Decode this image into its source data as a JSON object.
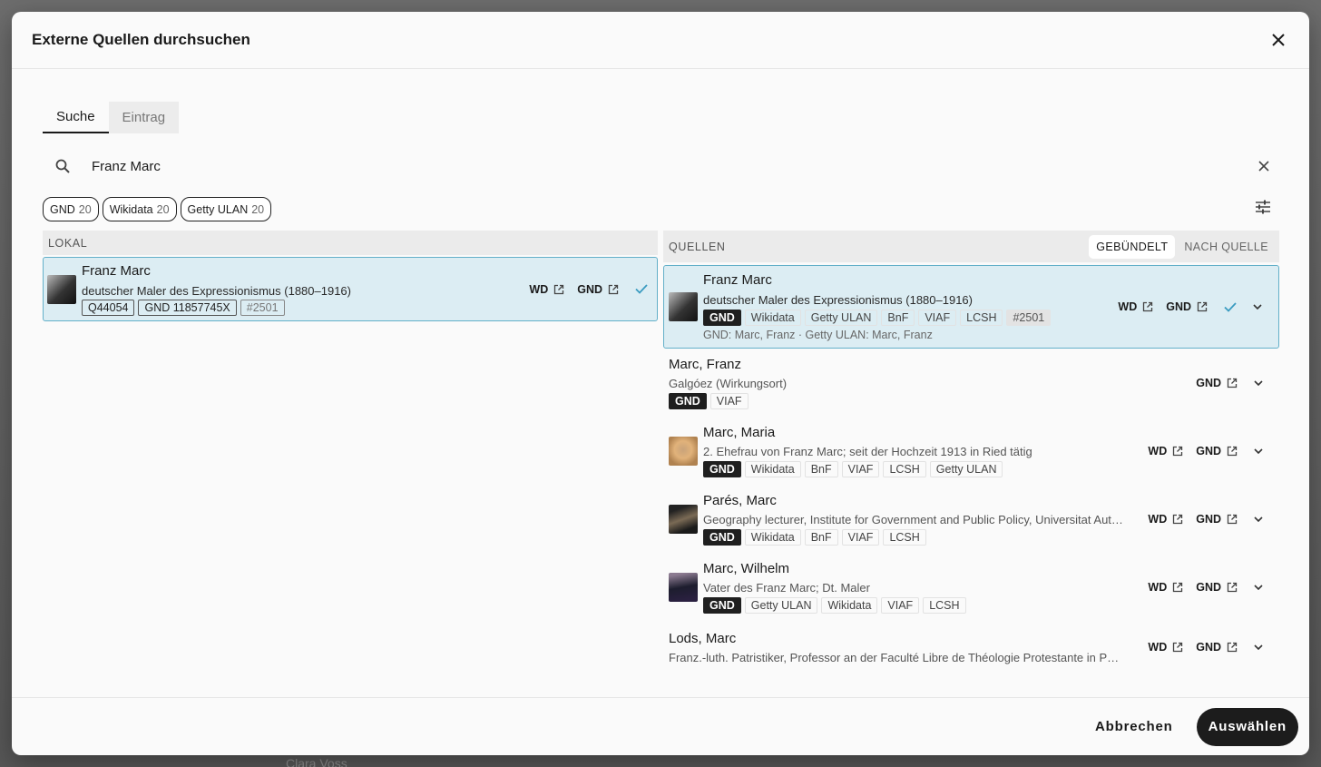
{
  "background": {
    "text": "Clara Voss"
  },
  "dialog": {
    "title": "Externe Quellen durchsuchen"
  },
  "tabs": [
    {
      "label": "Suche",
      "active": true
    },
    {
      "label": "Eintrag",
      "active": false
    }
  ],
  "search": {
    "value": "Franz Marc",
    "placeholder": ""
  },
  "chips": [
    {
      "label": "GND",
      "count": "20"
    },
    {
      "label": "Wikidata",
      "count": "20"
    },
    {
      "label": "Getty ULAN",
      "count": "20"
    }
  ],
  "local": {
    "header": "LOKAL",
    "items": [
      {
        "title": "Franz Marc",
        "subtitle": "deutscher Maler des Expressionismus (1880–1916)",
        "tags": [
          "Q44054",
          "GND 11857745X",
          "#2501"
        ],
        "links": [
          "WD",
          "GND"
        ]
      }
    ]
  },
  "sources": {
    "header": "QUELLEN",
    "modes": [
      "GEBÜNDELT",
      "NACH QUELLE"
    ],
    "items": [
      {
        "title": "Franz Marc",
        "subtitle": "deutscher Maler des Expressionismus (1880–1916)",
        "tags": [
          "GND",
          "Wikidata",
          "Getty ULAN",
          "BnF",
          "VIAF",
          "LCSH",
          "#2501"
        ],
        "note": "GND: Marc, Franz · Getty ULAN: Marc, Franz",
        "links": [
          "WD",
          "GND"
        ]
      },
      {
        "title": "Marc, Franz",
        "subtitle": "Galgóez (Wirkungsort)",
        "tags": [
          "GND",
          "VIAF"
        ],
        "links": [
          "GND"
        ]
      },
      {
        "title": "Marc, Maria",
        "subtitle": "2. Ehefrau von Franz Marc; seit der Hochzeit 1913 in Ried tätig",
        "tags": [
          "GND",
          "Wikidata",
          "BnF",
          "VIAF",
          "LCSH",
          "Getty ULAN"
        ],
        "links": [
          "WD",
          "GND"
        ]
      },
      {
        "title": "Parés, Marc",
        "subtitle": "Geography lecturer, Institute for Government and Public Policy, Universitat Autòn...",
        "tags": [
          "GND",
          "Wikidata",
          "BnF",
          "VIAF",
          "LCSH"
        ],
        "links": [
          "WD",
          "GND"
        ]
      },
      {
        "title": "Marc, Wilhelm",
        "subtitle": "Vater des Franz Marc; Dt. Maler",
        "tags": [
          "GND",
          "Getty ULAN",
          "Wikidata",
          "VIAF",
          "LCSH"
        ],
        "links": [
          "WD",
          "GND"
        ]
      },
      {
        "title": "Lods, Marc",
        "subtitle": "Franz.-luth. Patristiker, Professor an der Faculté Libre de Théologie Protestante in Paris",
        "links": [
          "WD",
          "GND"
        ]
      }
    ]
  },
  "footer": {
    "cancel": "Abbrechen",
    "confirm": "Auswählen"
  }
}
